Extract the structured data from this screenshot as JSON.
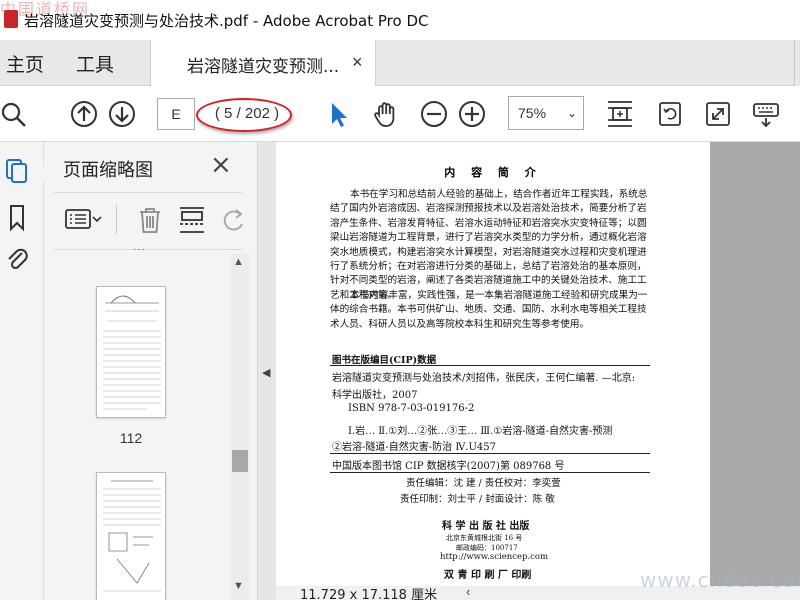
{
  "window": {
    "title": "岩溶隧道灾变预测与处治技术.pdf - Adobe Acrobat Pro DC",
    "watermark_left": "中国道桥网",
    "watermark_right": "www.cndao.com"
  },
  "menu": {
    "home_label": "主页",
    "tools_label": "工具"
  },
  "tab": {
    "label": "岩溶隧道灾变预测...",
    "close": "×"
  },
  "toolbar": {
    "page_input": "E",
    "page_count": "( 5 / 202 )",
    "zoom_value": "75%",
    "zoom_caret": "⌄"
  },
  "panel": {
    "title": "页面缩略图",
    "close": "×",
    "dots": "···",
    "thumbnails": [
      {
        "label": "112"
      },
      {
        "label": ""
      }
    ]
  },
  "status": {
    "page_size": "11.729 x 17.118 厘米",
    "arrow": "‹"
  },
  "pdf": {
    "title": "内 容 简 介",
    "para1": "本书在学习和总结前人经验的基础上，结合作者近年工程实践，系统总结了国内外岩溶成因、岩溶探测预报技术以及岩溶处治技术，简要分析了岩溶产生条件、岩溶发育特征、岩溶水运动特征和岩溶突水灾变特征等；以圆梁山岩溶隧道为工程背景，进行了岩溶突水类型的力学分析，通过概化岩溶突水地质模式，构建岩溶突水计算模型，对岩溶隧道突水过程和灾变机理进行了系统分析；在对岩溶进行分类的基础上，总结了岩溶处治的基本原则，针对不同类型的岩溶，阐述了各类岩溶隧道施工中的关键处治技术、施工工艺和工程对策。",
    "para2": "本书内容丰富，实践性强，是一本集岩溶隧道施工经验和研究成果为一体的综合书籍。本书可供矿山、地质、交通、国防、水利水电等相关工程技术人员、科研人员以及高等院校本科生和研究生等参考使用。",
    "cip_heading": "图书在版编目(CIP)数据",
    "cip_line1": "岩溶隧道灾变预测与处治技术/刘招伟，张民庆，王何仁编著. —北京:",
    "cip_line2": "科学出版社，2007",
    "cip_line3": "ISBN 978-7-03-019176-2",
    "cip_line4": "Ⅰ.岩…  Ⅱ.①刘…②张…③王…  Ⅲ.①岩溶-隧道-自然灾害-预测",
    "cip_line5": "②岩溶-隧道-自然灾害-防治  Ⅳ.U457",
    "cip_line6": "中国版本图书馆 CIP 数据核字(2007)第 089768 号",
    "editor_line": "责任编辑：沈  建 / 责任校对：李奕萱",
    "print_line": "责任印制：刘士平 / 封面设计：陈  敬",
    "publisher": "科 学 出 版 社  出版",
    "address": "北京东黄城根北街 16 号",
    "postcode": "邮政编码：100717",
    "website": "http://www.sciencep.com",
    "printer": "双 青 印 刷 厂 印刷"
  }
}
